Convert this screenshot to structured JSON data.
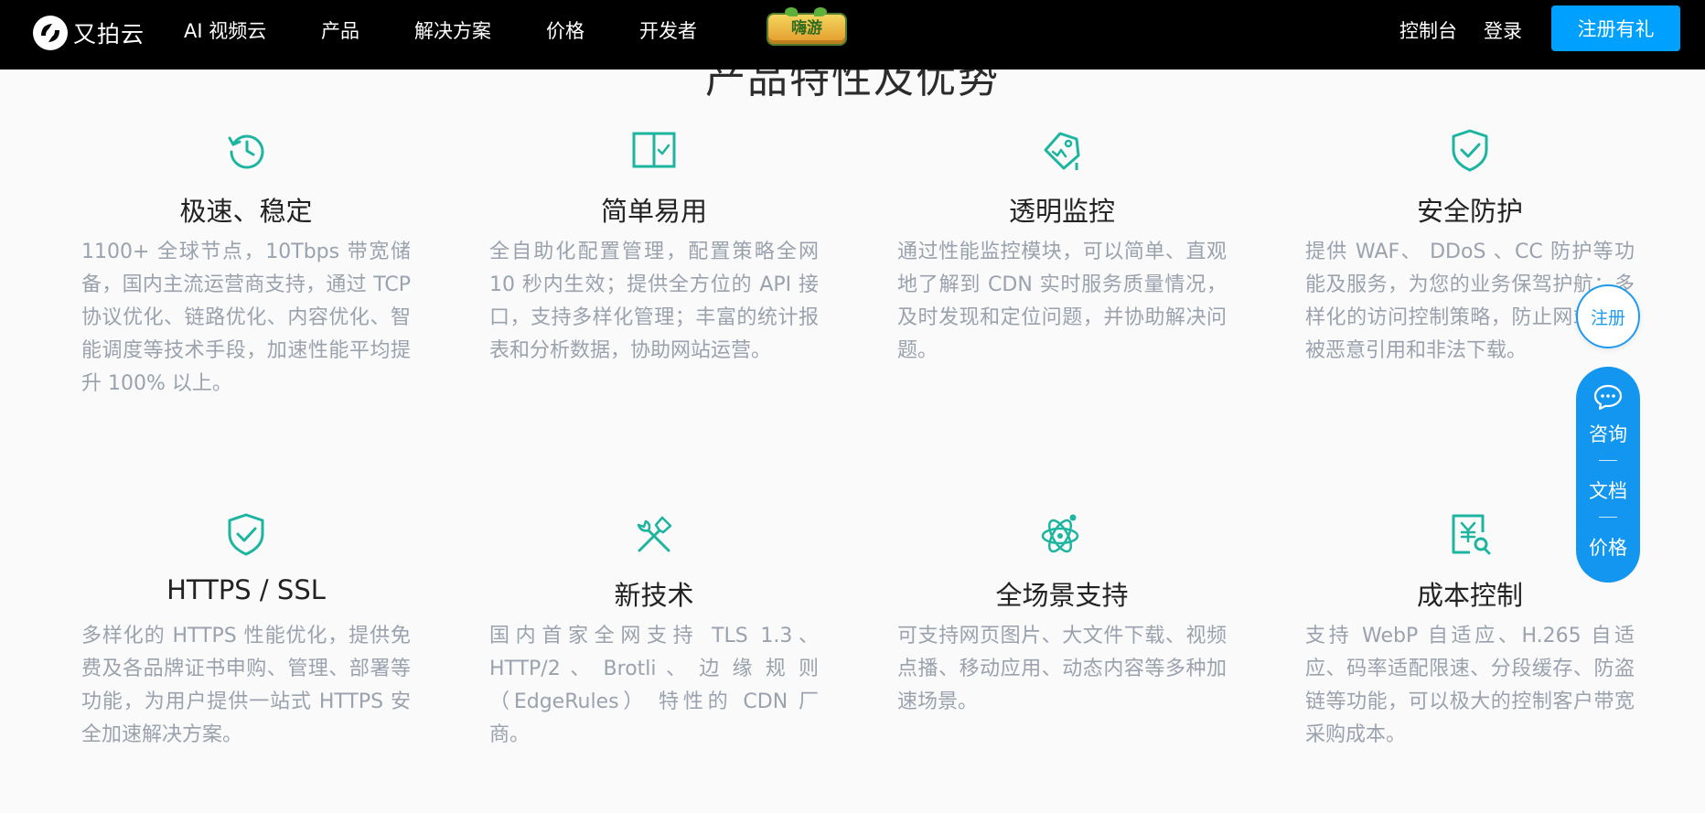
{
  "header": {
    "logo_text": "又拍云",
    "nav": [
      "AI 视频云",
      "产品",
      "解决方案",
      "价格",
      "开发者"
    ],
    "game_badge": "嗨游",
    "console": "控制台",
    "login": "登录",
    "signup": "注册有礼"
  },
  "section": {
    "title": "产品特性及优势"
  },
  "features": [
    {
      "name": "极速、稳定",
      "icon": "clock-refresh-icon",
      "desc": "1100+ 全球节点，10Tbps 带宽储备，国内主流运营商支持，通过 TCP 协议优化、链路优化、内容优化、智能调度等技术手段，加速性能平均提升 100% 以上。"
    },
    {
      "name": "简单易用",
      "icon": "split-panel-check-icon",
      "desc": "全自助化配置管理，配置策略全网 10 秒内生效；提供全方位的 API 接口，支持多样化管理；丰富的统计报表和分析数据，协助网站运营。"
    },
    {
      "name": "透明监控",
      "icon": "monitor-tag-icon",
      "desc": "通过性能监控模块，可以简单、直观地了解到 CDN 实时服务质量情况，及时发现和定位问题，并协助解决问题。"
    },
    {
      "name": "安全防护",
      "icon": "shield-check-icon",
      "desc": "提供 WAF、 DDoS 、CC 防护等功能及服务，为您的业务保驾护航；多样化的访问控制策略，防止网站内容被恶意引用和非法下载。"
    },
    {
      "name": "HTTPS / SSL",
      "icon": "ssl-shield-icon",
      "desc": "多样化的 HTTPS 性能优化，提供免费及各品牌证书申购、管理、部署等功能，为用户提供一站式 HTTPS 安全加速解决方案。"
    },
    {
      "name": "新技术",
      "icon": "tools-icon",
      "desc": "国内首家全网支持 TLS 1.3、HTTP/2 、 Brotli 、 边 缘 规 则 （EdgeRules） 特性的 CDN 厂商。"
    },
    {
      "name": "全场景支持",
      "icon": "atom-icon",
      "desc": "可支持网页图片、大文件下载、视频点播、移动应用、动态内容等多种加速场景。"
    },
    {
      "name": "成本控制",
      "icon": "yuan-doc-search-icon",
      "desc": "支持 WebP 自适应、H.265 自适应、码率适配限速、分段缓存、防盗链等功能，可以极大的控制客户带宽采购成本。"
    }
  ],
  "float_widget": {
    "signup": "注册",
    "consult": "咨询",
    "docs": "文档",
    "price": "价格"
  },
  "colors": {
    "accent_teal": "#1db5a0",
    "brand_blue": "#00a0ff",
    "float_blue": "#1296f0"
  }
}
